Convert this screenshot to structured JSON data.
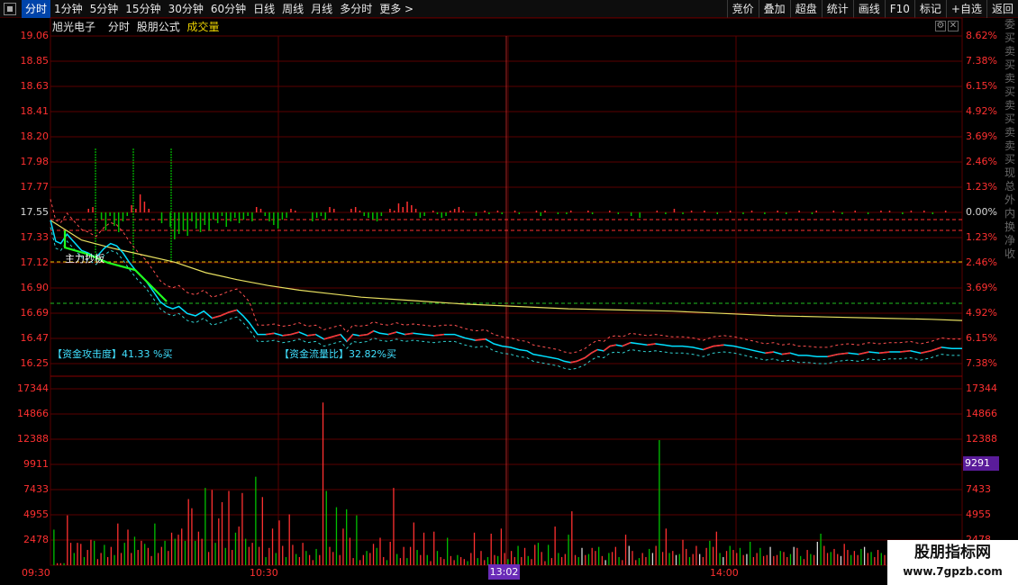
{
  "toolbar": {
    "tabs": [
      "分时",
      "1分钟",
      "5分钟",
      "15分钟",
      "30分钟",
      "60分钟",
      "日线",
      "周线",
      "月线",
      "多分时",
      "更多 >"
    ],
    "buttons": [
      "竞价",
      "叠加",
      "超盘",
      "统计",
      "画线",
      "F10",
      "标记",
      "+自选",
      "返回"
    ]
  },
  "info": {
    "stock_name": "旭光电子",
    "view": "分时",
    "formula": "股朋公式",
    "volume_label": "成交量"
  },
  "chart_data": {
    "type": "line",
    "price_axis": {
      "ticks": [
        "19.06",
        "18.85",
        "18.63",
        "18.41",
        "18.20",
        "17.98",
        "17.77",
        "17.55",
        "17.33",
        "17.12",
        "16.90",
        "16.69",
        "16.47",
        "16.25"
      ],
      "prev_close": 17.55,
      "ylim": [
        16.25,
        19.06
      ]
    },
    "pct_axis": {
      "ticks": [
        "8.62%",
        "7.38%",
        "6.15%",
        "4.92%",
        "3.69%",
        "2.46%",
        "1.23%",
        "0.00%",
        "1.23%",
        "2.46%",
        "3.69%",
        "4.92%",
        "6.15%",
        "7.38%"
      ]
    },
    "volume_axis": {
      "ticks": [
        "17344",
        "14866",
        "12388",
        "9911",
        "7433",
        "4955",
        "2478"
      ],
      "ylim": [
        0,
        17344
      ]
    },
    "time_axis": {
      "ticks": [
        "09:30",
        "10:30",
        "13:02",
        "14:00"
      ]
    },
    "crosshair": {
      "time": "13:02",
      "volume": "9291"
    },
    "price_series": [
      [
        0,
        17.48
      ],
      [
        5,
        17.3
      ],
      [
        10,
        17.28
      ],
      [
        16,
        17.36
      ],
      [
        22,
        17.3
      ],
      [
        30,
        17.22
      ],
      [
        36,
        17.2
      ],
      [
        44,
        17.16
      ],
      [
        52,
        17.24
      ],
      [
        58,
        17.28
      ],
      [
        64,
        17.26
      ],
      [
        70,
        17.2
      ],
      [
        76,
        17.12
      ],
      [
        84,
        17.03
      ],
      [
        92,
        16.96
      ],
      [
        100,
        16.86
      ],
      [
        106,
        16.78
      ],
      [
        112,
        16.74
      ],
      [
        118,
        16.72
      ],
      [
        124,
        16.74
      ],
      [
        132,
        16.68
      ],
      [
        140,
        16.66
      ],
      [
        148,
        16.7
      ],
      [
        156,
        16.64
      ],
      [
        164,
        16.66
      ],
      [
        172,
        16.69
      ],
      [
        180,
        16.71
      ],
      [
        186,
        16.66
      ],
      [
        192,
        16.6
      ],
      [
        200,
        16.5
      ],
      [
        208,
        16.5
      ],
      [
        216,
        16.51
      ],
      [
        224,
        16.49
      ],
      [
        232,
        16.5
      ],
      [
        240,
        16.52
      ],
      [
        248,
        16.49
      ],
      [
        256,
        16.5
      ],
      [
        264,
        16.46
      ],
      [
        272,
        16.48
      ],
      [
        280,
        16.5
      ],
      [
        286,
        16.44
      ],
      [
        292,
        16.5
      ],
      [
        298,
        16.49
      ],
      [
        306,
        16.5
      ],
      [
        312,
        16.53
      ],
      [
        318,
        16.51
      ],
      [
        326,
        16.5
      ],
      [
        334,
        16.52
      ],
      [
        342,
        16.5
      ],
      [
        350,
        16.51
      ],
      [
        360,
        16.5
      ],
      [
        370,
        16.49
      ],
      [
        380,
        16.5
      ],
      [
        390,
        16.5
      ],
      [
        400,
        16.47
      ],
      [
        410,
        16.45
      ],
      [
        420,
        16.46
      ],
      [
        428,
        16.42
      ],
      [
        436,
        16.4
      ],
      [
        444,
        16.39
      ],
      [
        452,
        16.37
      ],
      [
        460,
        16.36
      ],
      [
        466,
        16.33
      ],
      [
        472,
        16.32
      ],
      [
        478,
        16.31
      ],
      [
        484,
        16.3
      ],
      [
        490,
        16.29
      ],
      [
        496,
        16.27
      ],
      [
        502,
        16.26
      ],
      [
        508,
        16.27
      ],
      [
        516,
        16.3
      ],
      [
        522,
        16.34
      ],
      [
        528,
        16.37
      ],
      [
        534,
        16.36
      ],
      [
        540,
        16.4
      ],
      [
        546,
        16.41
      ],
      [
        552,
        16.4
      ],
      [
        560,
        16.43
      ],
      [
        568,
        16.42
      ],
      [
        576,
        16.41
      ],
      [
        584,
        16.42
      ],
      [
        592,
        16.41
      ],
      [
        600,
        16.4
      ],
      [
        610,
        16.4
      ],
      [
        620,
        16.39
      ],
      [
        630,
        16.37
      ],
      [
        640,
        16.4
      ],
      [
        650,
        16.41
      ],
      [
        660,
        16.4
      ],
      [
        670,
        16.38
      ],
      [
        680,
        16.36
      ],
      [
        690,
        16.34
      ],
      [
        698,
        16.35
      ],
      [
        706,
        16.33
      ],
      [
        714,
        16.34
      ],
      [
        722,
        16.32
      ],
      [
        730,
        16.32
      ],
      [
        740,
        16.31
      ],
      [
        750,
        16.31
      ],
      [
        760,
        16.33
      ],
      [
        770,
        16.34
      ],
      [
        780,
        16.33
      ],
      [
        790,
        16.35
      ],
      [
        800,
        16.34
      ],
      [
        810,
        16.35
      ],
      [
        820,
        16.35
      ],
      [
        830,
        16.36
      ],
      [
        840,
        16.34
      ],
      [
        850,
        16.36
      ],
      [
        860,
        16.39
      ],
      [
        870,
        16.38
      ],
      [
        880,
        16.38
      ]
    ],
    "avg_series": [
      [
        0,
        17.48
      ],
      [
        30,
        17.31
      ],
      [
        60,
        17.24
      ],
      [
        90,
        17.18
      ],
      [
        120,
        17.12
      ],
      [
        150,
        17.03
      ],
      [
        180,
        16.97
      ],
      [
        210,
        16.92
      ],
      [
        240,
        16.88
      ],
      [
        270,
        16.85
      ],
      [
        300,
        16.82
      ],
      [
        350,
        16.79
      ],
      [
        400,
        16.76
      ],
      [
        450,
        16.74
      ],
      [
        500,
        16.72
      ],
      [
        550,
        16.71
      ],
      [
        600,
        16.7
      ],
      [
        650,
        16.68
      ],
      [
        700,
        16.66
      ],
      [
        750,
        16.65
      ],
      [
        800,
        16.64
      ],
      [
        850,
        16.63
      ],
      [
        880,
        16.62
      ]
    ],
    "volume": [
      3500,
      200,
      200,
      200,
      4900,
      2200,
      1200,
      2200,
      2100,
      800,
      1500,
      2500,
      2400,
      600,
      1200,
      2000,
      800,
      1800,
      1000,
      4100,
      1200,
      2200,
      3500,
      1200,
      2800,
      1500,
      2400,
      2100,
      1700,
      900,
      4100,
      1200,
      1800,
      2400,
      1400,
      3200,
      2600,
      3000,
      3600,
      2400,
      6500,
      5600,
      2400,
      3300,
      2600,
      7600,
      1300,
      7400,
      2200,
      4600,
      6200,
      1700,
      7300,
      1500,
      3200,
      3800,
      7100,
      2600,
      1800,
      2200,
      8700,
      1800,
      6700,
      800,
      1700,
      3600,
      1200,
      4400,
      1900,
      800,
      5000,
      2000,
      1100,
      800,
      2200,
      1400,
      1000,
      500,
      1600,
      1000,
      16000,
      7300,
      1800,
      1300,
      5700,
      1000,
      3600,
      5500,
      2700,
      700,
      4900,
      500,
      1000,
      1400,
      1200,
      2100,
      1700,
      2700,
      800,
      500,
      2300,
      7600,
      1100,
      700,
      1800,
      700,
      1800,
      4200,
      1500,
      1000,
      3200,
      1000,
      400,
      3300,
      1400,
      800,
      600,
      2700,
      900,
      500,
      1000,
      800,
      600,
      400,
      1200,
      3200,
      700,
      1400,
      500,
      800,
      3100,
      1000,
      900,
      3600,
      1200,
      600,
      1400,
      800,
      1900,
      800,
      1700,
      900,
      600,
      2000,
      2200,
      1300,
      400,
      2000,
      700,
      3800,
      1200,
      800,
      1100,
      3000,
      5300,
      1000,
      800,
      1700,
      1000,
      1100,
      1700,
      1400,
      1800,
      900,
      500,
      1200,
      1300,
      1800,
      800,
      500,
      3000,
      1900,
      1400,
      500,
      700,
      1200,
      800,
      1600,
      1200,
      1900,
      12300,
      1300,
      3600,
      1200,
      1400,
      1000,
      1100,
      2500,
      1600,
      800,
      1100,
      1900,
      1100,
      800,
      1700,
      2400,
      1800,
      3300,
      1200,
      800,
      1400,
      1900,
      1500,
      1200,
      1700,
      1000,
      1100,
      2300,
      800,
      1200,
      1700,
      900,
      1000,
      1800,
      900,
      1000,
      1400,
      1300,
      800,
      1100,
      1800,
      1700,
      900,
      600,
      1500,
      1100,
      1000,
      2300,
      3100,
      1900,
      1200,
      1300,
      1600,
      1100,
      900,
      2100,
      1500,
      1000,
      1400,
      1000,
      1600,
      1800,
      1200,
      1300,
      800,
      1500,
      1200,
      1000,
      1800,
      1400,
      1100,
      900,
      1700,
      1200,
      1000,
      1600,
      1300,
      1100,
      900,
      1200,
      1500,
      1400,
      1000,
      1200,
      1800,
      2000,
      1100,
      1300,
      1500,
      1900
    ],
    "indicator_bars": [
      0,
      0,
      0,
      0,
      0,
      0,
      0,
      0,
      4,
      6,
      0,
      -8,
      -20,
      -4,
      -15,
      -22,
      -10,
      -4,
      8,
      4,
      20,
      12,
      4,
      0,
      0,
      -12,
      0,
      -16,
      -30,
      -24,
      -20,
      -26,
      -10,
      -18,
      -22,
      -14,
      -20,
      -8,
      -12,
      -4,
      -16,
      -10,
      -6,
      -12,
      -8,
      -4,
      -10,
      6,
      4,
      -4,
      -10,
      -14,
      -18,
      -8,
      -6,
      4,
      2,
      0,
      0,
      0,
      -10,
      -6,
      -4,
      -8,
      6,
      4,
      0,
      0,
      0,
      4,
      6,
      2,
      -4,
      -6,
      -8,
      -10,
      -4,
      0,
      4,
      2,
      10,
      6,
      12,
      8,
      4,
      -6,
      -4,
      0,
      2,
      -2,
      -6,
      -4,
      2,
      4,
      6,
      2,
      0,
      0,
      -4,
      0,
      2,
      -2,
      0,
      2,
      -2,
      0,
      0,
      2,
      -2,
      0,
      0,
      0,
      2,
      -4,
      2,
      0,
      0,
      -2,
      0,
      -2,
      2,
      0,
      0,
      0,
      2,
      -2,
      0,
      0,
      0,
      2,
      0,
      -2,
      0,
      0,
      -4,
      0,
      -6,
      0,
      0,
      0,
      2,
      0,
      -2,
      0,
      4,
      0,
      -2,
      0,
      2,
      0,
      0,
      2,
      0,
      0,
      -2,
      0,
      0,
      2,
      0,
      0,
      -2,
      0,
      2,
      0,
      0,
      -2,
      0,
      0,
      2,
      0,
      -2,
      0,
      0,
      2,
      0,
      0,
      -2,
      2,
      0,
      0,
      0,
      2,
      0,
      -2,
      0,
      0,
      2,
      0,
      0,
      -2,
      0,
      0,
      2,
      0,
      2,
      0,
      0,
      -2,
      0,
      2,
      0,
      0,
      2,
      0,
      -2,
      0,
      0,
      2,
      0,
      0
    ],
    "tall_green_spikes": [
      106,
      148,
      190
    ],
    "annotations": {
      "main_force": "主力抄板",
      "attack": "【资金攻击度】41.33 %买",
      "flow": "【资金流量比】32.82%买"
    },
    "colors": {
      "price": "#00e0ff",
      "avg": "#e8e060",
      "up": "#ff3030",
      "down": "#00c000",
      "grid": "#5a0000"
    }
  },
  "watermark": {
    "title": "股朋指标网",
    "url": "www.7gpzb.com"
  },
  "side_strip": [
    "委",
    "买",
    "卖",
    "买",
    "卖",
    "买",
    "卖",
    "买",
    "卖",
    "卖",
    "买",
    "现",
    "总",
    "外",
    "内",
    "换",
    "净",
    "收"
  ]
}
